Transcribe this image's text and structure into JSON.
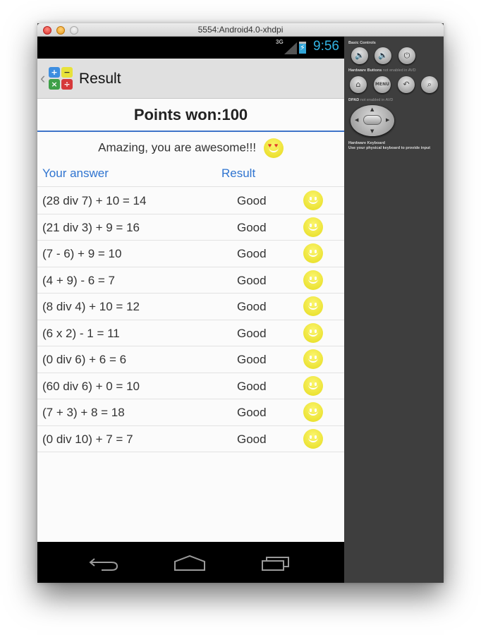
{
  "window": {
    "title": "5554:Android4.0-xhdpi"
  },
  "status_bar": {
    "network": "3G",
    "time": "9:56",
    "battery_icon": "battery-charging-icon"
  },
  "action_bar": {
    "title": "Result",
    "app_icon_symbols": [
      "+",
      "−",
      "×",
      "÷"
    ]
  },
  "result": {
    "points_label": "Points won:100",
    "message": "Amazing, you are awesome!!!",
    "message_icon": "heart-eyes-emoji-icon"
  },
  "table": {
    "headers": [
      "Your answer",
      "Result"
    ],
    "rows": [
      {
        "answer": "(28 div 7) + 10 = 14",
        "result": "Good",
        "icon": "smiley-icon"
      },
      {
        "answer": "(21 div 3) + 9 = 16",
        "result": "Good",
        "icon": "smiley-icon"
      },
      {
        "answer": "(7 - 6) + 9 = 10",
        "result": "Good",
        "icon": "smiley-icon"
      },
      {
        "answer": "(4 + 9) - 6 = 7",
        "result": "Good",
        "icon": "smiley-icon"
      },
      {
        "answer": "(8 div 4) + 10 = 12",
        "result": "Good",
        "icon": "smiley-icon"
      },
      {
        "answer": "(6 x 2) - 1 = 11",
        "result": "Good",
        "icon": "smiley-icon"
      },
      {
        "answer": "(0 div 6) + 6 = 6",
        "result": "Good",
        "icon": "smiley-icon"
      },
      {
        "answer": "(60 div 6) + 0 = 10",
        "result": "Good",
        "icon": "smiley-icon"
      },
      {
        "answer": "(7 + 3) + 8 = 18",
        "result": "Good",
        "icon": "smiley-icon"
      },
      {
        "answer": "(0 div 10) + 7 = 7",
        "result": "Good",
        "icon": "smiley-icon"
      }
    ]
  },
  "nav_bar": {
    "buttons": [
      "back",
      "home",
      "recent-apps"
    ]
  },
  "emulator_panel": {
    "basic_controls_label": "Basic Controls",
    "hardware_buttons_label": "Hardware Buttons",
    "hardware_buttons_note": "not enabled in AVD",
    "dpad_label": "DPAD",
    "dpad_note": "not enabled in AVD",
    "keyboard_label": "Hardware Keyboard",
    "keyboard_note": "Use your physical keyboard to provide input",
    "menu_label": "MENU"
  },
  "colors": {
    "accent_blue": "#2f74d0",
    "divider_blue": "#3f74c9",
    "clock_blue": "#33b5e5",
    "smiley_yellow": "#f0e63a"
  }
}
